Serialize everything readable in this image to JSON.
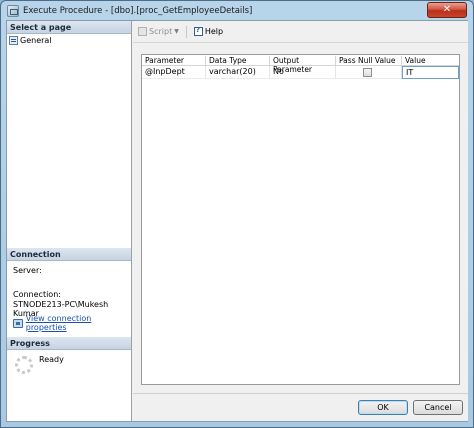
{
  "window": {
    "title": "Execute Procedure - [dbo].[proc_GetEmployeeDetails]",
    "close_glyph": "✕"
  },
  "left": {
    "select_page_header": "Select a page",
    "pages": [
      {
        "label": "General",
        "icon": "page-icon"
      }
    ],
    "connection_header": "Connection",
    "server_label": "Server:",
    "connection_label": "Connection:",
    "connection_value": "STNODE213-PC\\Mukesh Kumar",
    "view_props_link": "View connection properties",
    "progress_header": "Progress",
    "progress_status": "Ready"
  },
  "toolbar": {
    "script_label": "Script",
    "script_dropdown": "▼",
    "help_label": "Help"
  },
  "grid": {
    "columns": [
      "Parameter",
      "Data Type",
      "Output Parameter",
      "Pass Null Value",
      "Value"
    ],
    "rows": [
      {
        "parameter": "@InpDept",
        "data_type": "varchar(20)",
        "output": "No",
        "pass_null": false,
        "value": "IT"
      }
    ]
  },
  "buttons": {
    "ok": "OK",
    "cancel": "Cancel"
  },
  "colors": {
    "link": "#1a4fb0",
    "accent_border": "#3c7fb1"
  }
}
